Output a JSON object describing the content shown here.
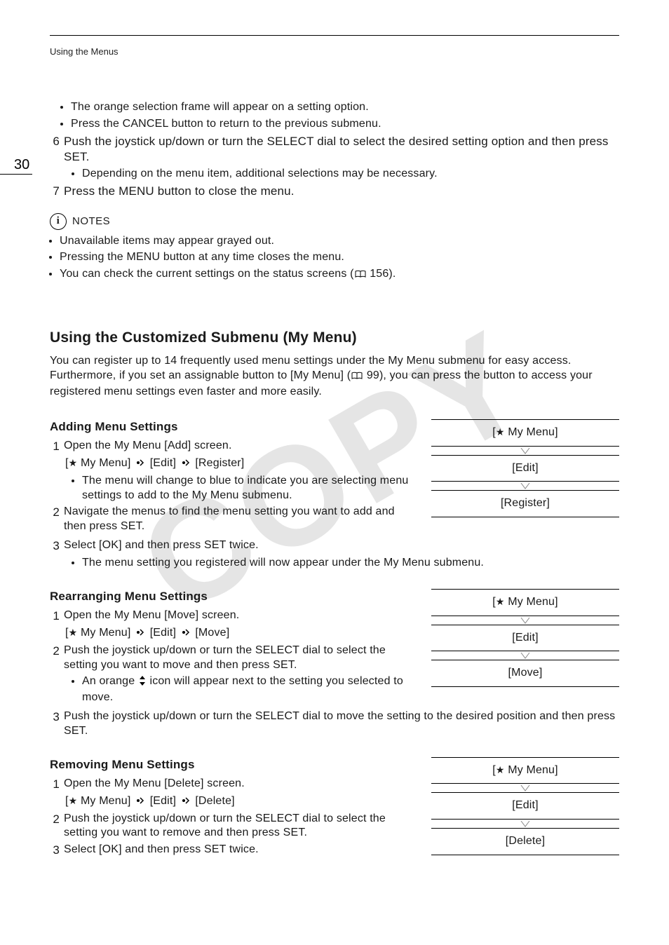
{
  "header": {
    "running_head": "Using the Menus",
    "page_number": "30"
  },
  "watermark": "COPY",
  "top_bullets": [
    "The orange selection frame will appear on a setting option.",
    "Press the CANCEL button to return to the previous submenu."
  ],
  "step6": {
    "num": "6",
    "text": "Push the joystick up/down or turn the SELECT dial to select the desired setting option and then press SET.",
    "bullets": [
      "Depending on the menu item, additional selections may be necessary."
    ]
  },
  "step7": {
    "num": "7",
    "text": "Press the MENU button to close the menu."
  },
  "notes": {
    "label": "NOTES",
    "items": [
      "Unavailable items may appear grayed out.",
      "Pressing the MENU button at any time closes the menu."
    ],
    "status_line": {
      "pre": "You can check the current settings on the status screens (",
      "ref": "156",
      "post": ")."
    }
  },
  "my_menu": {
    "title": "Using the Customized Submenu (My Menu)",
    "intro": {
      "pre": "You can register up to 14 frequently used menu settings under the My Menu submenu for easy access. Furthermore, if you set an assignable button to [My Menu] (",
      "ref": "99",
      "post": "), you can press the button to access your registered menu settings even faster and more easily."
    },
    "breadcrumb_label": "My Menu",
    "adding": {
      "title": "Adding Menu Settings",
      "steps": {
        "s1": {
          "num": "1",
          "text": "Open the My Menu [Add] screen."
        },
        "breadcrumb": {
          "a": "My Menu",
          "b": "[Edit]",
          "c": "[Register]"
        },
        "s1_sub": [
          "The menu will change to blue to indicate you are selecting menu settings to add to the My Menu submenu."
        ],
        "s2": {
          "num": "2",
          "text": "Navigate the menus to find the menu setting you want to add and then press SET."
        },
        "s3": {
          "num": "3",
          "text": "Select [OK] and then press SET twice."
        },
        "s3_sub": [
          "The menu setting you registered will now appear under the My Menu submenu."
        ]
      },
      "path": [
        "My Menu",
        "[Edit]",
        "[Register]"
      ]
    },
    "rearranging": {
      "title": "Rearranging Menu Settings",
      "steps": {
        "s1": {
          "num": "1",
          "text": "Open the My Menu [Move] screen."
        },
        "breadcrumb": {
          "a": "My Menu",
          "b": "[Edit]",
          "c": "[Move]"
        },
        "s2": {
          "num": "2",
          "text": "Push the joystick up/down or turn the SELECT dial to select the setting you want to move and then press SET."
        },
        "s2_sub_pre": "An orange ",
        "s2_sub_post": " icon will appear next to the setting you selected to move.",
        "s3": {
          "num": "3",
          "text": "Push the joystick up/down or turn the SELECT dial to move the setting to the desired position and then press SET."
        }
      },
      "path": [
        "My Menu",
        "[Edit]",
        "[Move]"
      ]
    },
    "removing": {
      "title": "Removing Menu Settings",
      "steps": {
        "s1": {
          "num": "1",
          "text": "Open the My Menu [Delete] screen."
        },
        "breadcrumb": {
          "a": "My Menu",
          "b": "[Edit]",
          "c": "[Delete]"
        },
        "s2": {
          "num": "2",
          "text": "Push the joystick up/down or turn the SELECT dial to select the setting you want to remove and then press SET."
        },
        "s3": {
          "num": "3",
          "text": "Select [OK] and then press SET twice."
        }
      },
      "path": [
        "My Menu",
        "[Edit]",
        "[Delete]"
      ]
    }
  }
}
